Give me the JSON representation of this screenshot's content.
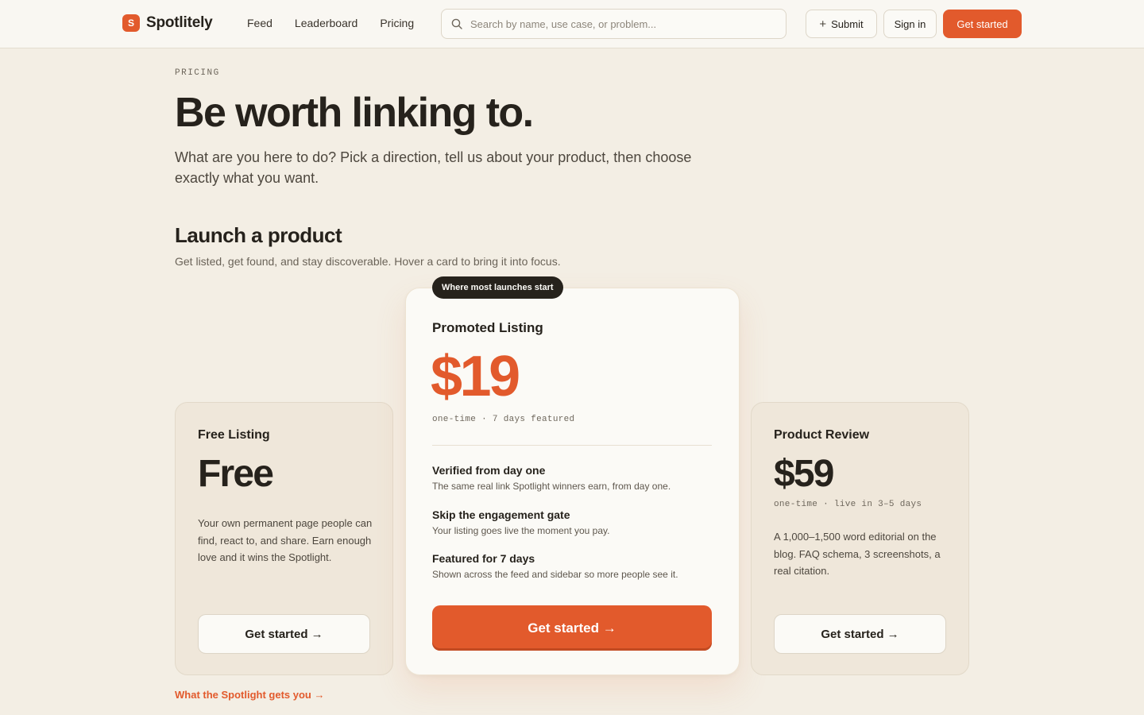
{
  "header": {
    "logo_mark": "S",
    "brand": "Spotlitely",
    "nav": [
      "Feed",
      "Leaderboard",
      "Pricing"
    ],
    "search_placeholder": "Search by name, use case, or problem...",
    "submit_label": "Submit",
    "signin_label": "Sign in",
    "cta_label": "Get started"
  },
  "hero": {
    "eyebrow": "PRICING",
    "title": "Be worth linking to.",
    "subtitle": "What are you here to do? Pick a direction, tell us about your product, then choose exactly what you want."
  },
  "section": {
    "title": "Launch a product",
    "subtitle": "Get listed, get found, and stay discoverable. Hover a card to bring it into focus."
  },
  "plans": {
    "free": {
      "name": "Free Listing",
      "price": "Free",
      "description": "Your own permanent page people can find, react to, and share. Earn enough love and it wins the Spotlight.",
      "cta": "Get started →"
    },
    "promoted": {
      "badge": "Where most launches start",
      "name": "Promoted Listing",
      "price": "$19",
      "meta": "one-time · 7 days featured",
      "features": [
        {
          "title": "Verified from day one",
          "desc": "The same real link Spotlight winners earn, from day one."
        },
        {
          "title": "Skip the engagement gate",
          "desc": "Your listing goes live the moment you pay."
        },
        {
          "title": "Featured for 7 days",
          "desc": "Shown across the feed and sidebar so more people see it."
        }
      ],
      "cta": "Get started →"
    },
    "review": {
      "name": "Product Review",
      "price": "$59",
      "meta": "one-time · live in 3–5 days",
      "description": "A 1,000–1,500 word editorial on the blog. FAQ schema, 3 screenshots, a real citation.",
      "cta": "Get started →"
    }
  },
  "footer_link": "What the Spotlight gets you →",
  "colors": {
    "accent": "#e25a2c",
    "background": "#f3eee4",
    "ink": "#26221c"
  }
}
